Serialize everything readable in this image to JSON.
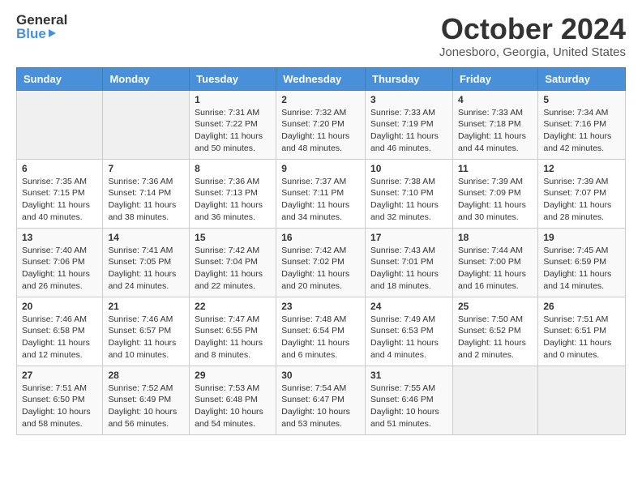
{
  "header": {
    "logo_line1": "General",
    "logo_line2": "Blue",
    "month_title": "October 2024",
    "location": "Jonesboro, Georgia, United States"
  },
  "calendar": {
    "days_of_week": [
      "Sunday",
      "Monday",
      "Tuesday",
      "Wednesday",
      "Thursday",
      "Friday",
      "Saturday"
    ],
    "weeks": [
      [
        {
          "day": "",
          "sunrise": "",
          "sunset": "",
          "daylight": "",
          "empty": true
        },
        {
          "day": "",
          "sunrise": "",
          "sunset": "",
          "daylight": "",
          "empty": true
        },
        {
          "day": "1",
          "sunrise": "Sunrise: 7:31 AM",
          "sunset": "Sunset: 7:22 PM",
          "daylight": "Daylight: 11 hours and 50 minutes.",
          "empty": false
        },
        {
          "day": "2",
          "sunrise": "Sunrise: 7:32 AM",
          "sunset": "Sunset: 7:20 PM",
          "daylight": "Daylight: 11 hours and 48 minutes.",
          "empty": false
        },
        {
          "day": "3",
          "sunrise": "Sunrise: 7:33 AM",
          "sunset": "Sunset: 7:19 PM",
          "daylight": "Daylight: 11 hours and 46 minutes.",
          "empty": false
        },
        {
          "day": "4",
          "sunrise": "Sunrise: 7:33 AM",
          "sunset": "Sunset: 7:18 PM",
          "daylight": "Daylight: 11 hours and 44 minutes.",
          "empty": false
        },
        {
          "day": "5",
          "sunrise": "Sunrise: 7:34 AM",
          "sunset": "Sunset: 7:16 PM",
          "daylight": "Daylight: 11 hours and 42 minutes.",
          "empty": false
        }
      ],
      [
        {
          "day": "6",
          "sunrise": "Sunrise: 7:35 AM",
          "sunset": "Sunset: 7:15 PM",
          "daylight": "Daylight: 11 hours and 40 minutes.",
          "empty": false
        },
        {
          "day": "7",
          "sunrise": "Sunrise: 7:36 AM",
          "sunset": "Sunset: 7:14 PM",
          "daylight": "Daylight: 11 hours and 38 minutes.",
          "empty": false
        },
        {
          "day": "8",
          "sunrise": "Sunrise: 7:36 AM",
          "sunset": "Sunset: 7:13 PM",
          "daylight": "Daylight: 11 hours and 36 minutes.",
          "empty": false
        },
        {
          "day": "9",
          "sunrise": "Sunrise: 7:37 AM",
          "sunset": "Sunset: 7:11 PM",
          "daylight": "Daylight: 11 hours and 34 minutes.",
          "empty": false
        },
        {
          "day": "10",
          "sunrise": "Sunrise: 7:38 AM",
          "sunset": "Sunset: 7:10 PM",
          "daylight": "Daylight: 11 hours and 32 minutes.",
          "empty": false
        },
        {
          "day": "11",
          "sunrise": "Sunrise: 7:39 AM",
          "sunset": "Sunset: 7:09 PM",
          "daylight": "Daylight: 11 hours and 30 minutes.",
          "empty": false
        },
        {
          "day": "12",
          "sunrise": "Sunrise: 7:39 AM",
          "sunset": "Sunset: 7:07 PM",
          "daylight": "Daylight: 11 hours and 28 minutes.",
          "empty": false
        }
      ],
      [
        {
          "day": "13",
          "sunrise": "Sunrise: 7:40 AM",
          "sunset": "Sunset: 7:06 PM",
          "daylight": "Daylight: 11 hours and 26 minutes.",
          "empty": false
        },
        {
          "day": "14",
          "sunrise": "Sunrise: 7:41 AM",
          "sunset": "Sunset: 7:05 PM",
          "daylight": "Daylight: 11 hours and 24 minutes.",
          "empty": false
        },
        {
          "day": "15",
          "sunrise": "Sunrise: 7:42 AM",
          "sunset": "Sunset: 7:04 PM",
          "daylight": "Daylight: 11 hours and 22 minutes.",
          "empty": false
        },
        {
          "day": "16",
          "sunrise": "Sunrise: 7:42 AM",
          "sunset": "Sunset: 7:02 PM",
          "daylight": "Daylight: 11 hours and 20 minutes.",
          "empty": false
        },
        {
          "day": "17",
          "sunrise": "Sunrise: 7:43 AM",
          "sunset": "Sunset: 7:01 PM",
          "daylight": "Daylight: 11 hours and 18 minutes.",
          "empty": false
        },
        {
          "day": "18",
          "sunrise": "Sunrise: 7:44 AM",
          "sunset": "Sunset: 7:00 PM",
          "daylight": "Daylight: 11 hours and 16 minutes.",
          "empty": false
        },
        {
          "day": "19",
          "sunrise": "Sunrise: 7:45 AM",
          "sunset": "Sunset: 6:59 PM",
          "daylight": "Daylight: 11 hours and 14 minutes.",
          "empty": false
        }
      ],
      [
        {
          "day": "20",
          "sunrise": "Sunrise: 7:46 AM",
          "sunset": "Sunset: 6:58 PM",
          "daylight": "Daylight: 11 hours and 12 minutes.",
          "empty": false
        },
        {
          "day": "21",
          "sunrise": "Sunrise: 7:46 AM",
          "sunset": "Sunset: 6:57 PM",
          "daylight": "Daylight: 11 hours and 10 minutes.",
          "empty": false
        },
        {
          "day": "22",
          "sunrise": "Sunrise: 7:47 AM",
          "sunset": "Sunset: 6:55 PM",
          "daylight": "Daylight: 11 hours and 8 minutes.",
          "empty": false
        },
        {
          "day": "23",
          "sunrise": "Sunrise: 7:48 AM",
          "sunset": "Sunset: 6:54 PM",
          "daylight": "Daylight: 11 hours and 6 minutes.",
          "empty": false
        },
        {
          "day": "24",
          "sunrise": "Sunrise: 7:49 AM",
          "sunset": "Sunset: 6:53 PM",
          "daylight": "Daylight: 11 hours and 4 minutes.",
          "empty": false
        },
        {
          "day": "25",
          "sunrise": "Sunrise: 7:50 AM",
          "sunset": "Sunset: 6:52 PM",
          "daylight": "Daylight: 11 hours and 2 minutes.",
          "empty": false
        },
        {
          "day": "26",
          "sunrise": "Sunrise: 7:51 AM",
          "sunset": "Sunset: 6:51 PM",
          "daylight": "Daylight: 11 hours and 0 minutes.",
          "empty": false
        }
      ],
      [
        {
          "day": "27",
          "sunrise": "Sunrise: 7:51 AM",
          "sunset": "Sunset: 6:50 PM",
          "daylight": "Daylight: 10 hours and 58 minutes.",
          "empty": false
        },
        {
          "day": "28",
          "sunrise": "Sunrise: 7:52 AM",
          "sunset": "Sunset: 6:49 PM",
          "daylight": "Daylight: 10 hours and 56 minutes.",
          "empty": false
        },
        {
          "day": "29",
          "sunrise": "Sunrise: 7:53 AM",
          "sunset": "Sunset: 6:48 PM",
          "daylight": "Daylight: 10 hours and 54 minutes.",
          "empty": false
        },
        {
          "day": "30",
          "sunrise": "Sunrise: 7:54 AM",
          "sunset": "Sunset: 6:47 PM",
          "daylight": "Daylight: 10 hours and 53 minutes.",
          "empty": false
        },
        {
          "day": "31",
          "sunrise": "Sunrise: 7:55 AM",
          "sunset": "Sunset: 6:46 PM",
          "daylight": "Daylight: 10 hours and 51 minutes.",
          "empty": false
        },
        {
          "day": "",
          "sunrise": "",
          "sunset": "",
          "daylight": "",
          "empty": true
        },
        {
          "day": "",
          "sunrise": "",
          "sunset": "",
          "daylight": "",
          "empty": true
        }
      ]
    ]
  }
}
